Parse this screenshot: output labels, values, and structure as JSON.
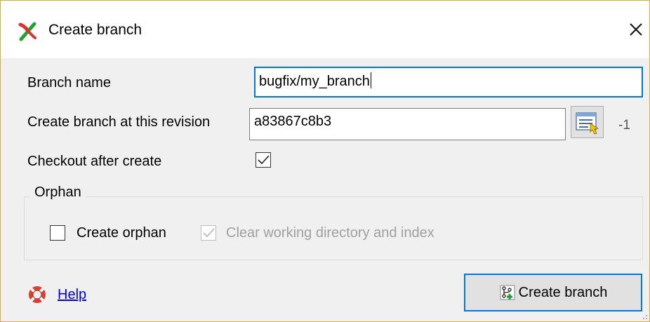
{
  "window": {
    "title": "Create branch"
  },
  "form": {
    "branch_name_label": "Branch name",
    "branch_name_value": "bugfix/my_branch",
    "revision_label": "Create branch at this revision",
    "revision_value": "a83867c8b3",
    "revision_count": "-1",
    "checkout_label": "Checkout after create",
    "checkout_checked": true
  },
  "orphan": {
    "group_label": "Orphan",
    "create_orphan_label": "Create orphan",
    "create_orphan_checked": false,
    "clear_label": "Clear working directory and index",
    "clear_checked": true,
    "clear_enabled": false
  },
  "footer": {
    "help_label": "Help",
    "create_button_label": "Create branch"
  },
  "icons": {
    "app": "git-branch-icon",
    "close": "close-icon",
    "revision_picker": "revision-picker-icon",
    "help": "lifebuoy-icon",
    "create": "create-branch-icon"
  },
  "colors": {
    "accent": "#0078d7",
    "titlebar_border": "#d4ad3e",
    "link": "#0000ee"
  }
}
